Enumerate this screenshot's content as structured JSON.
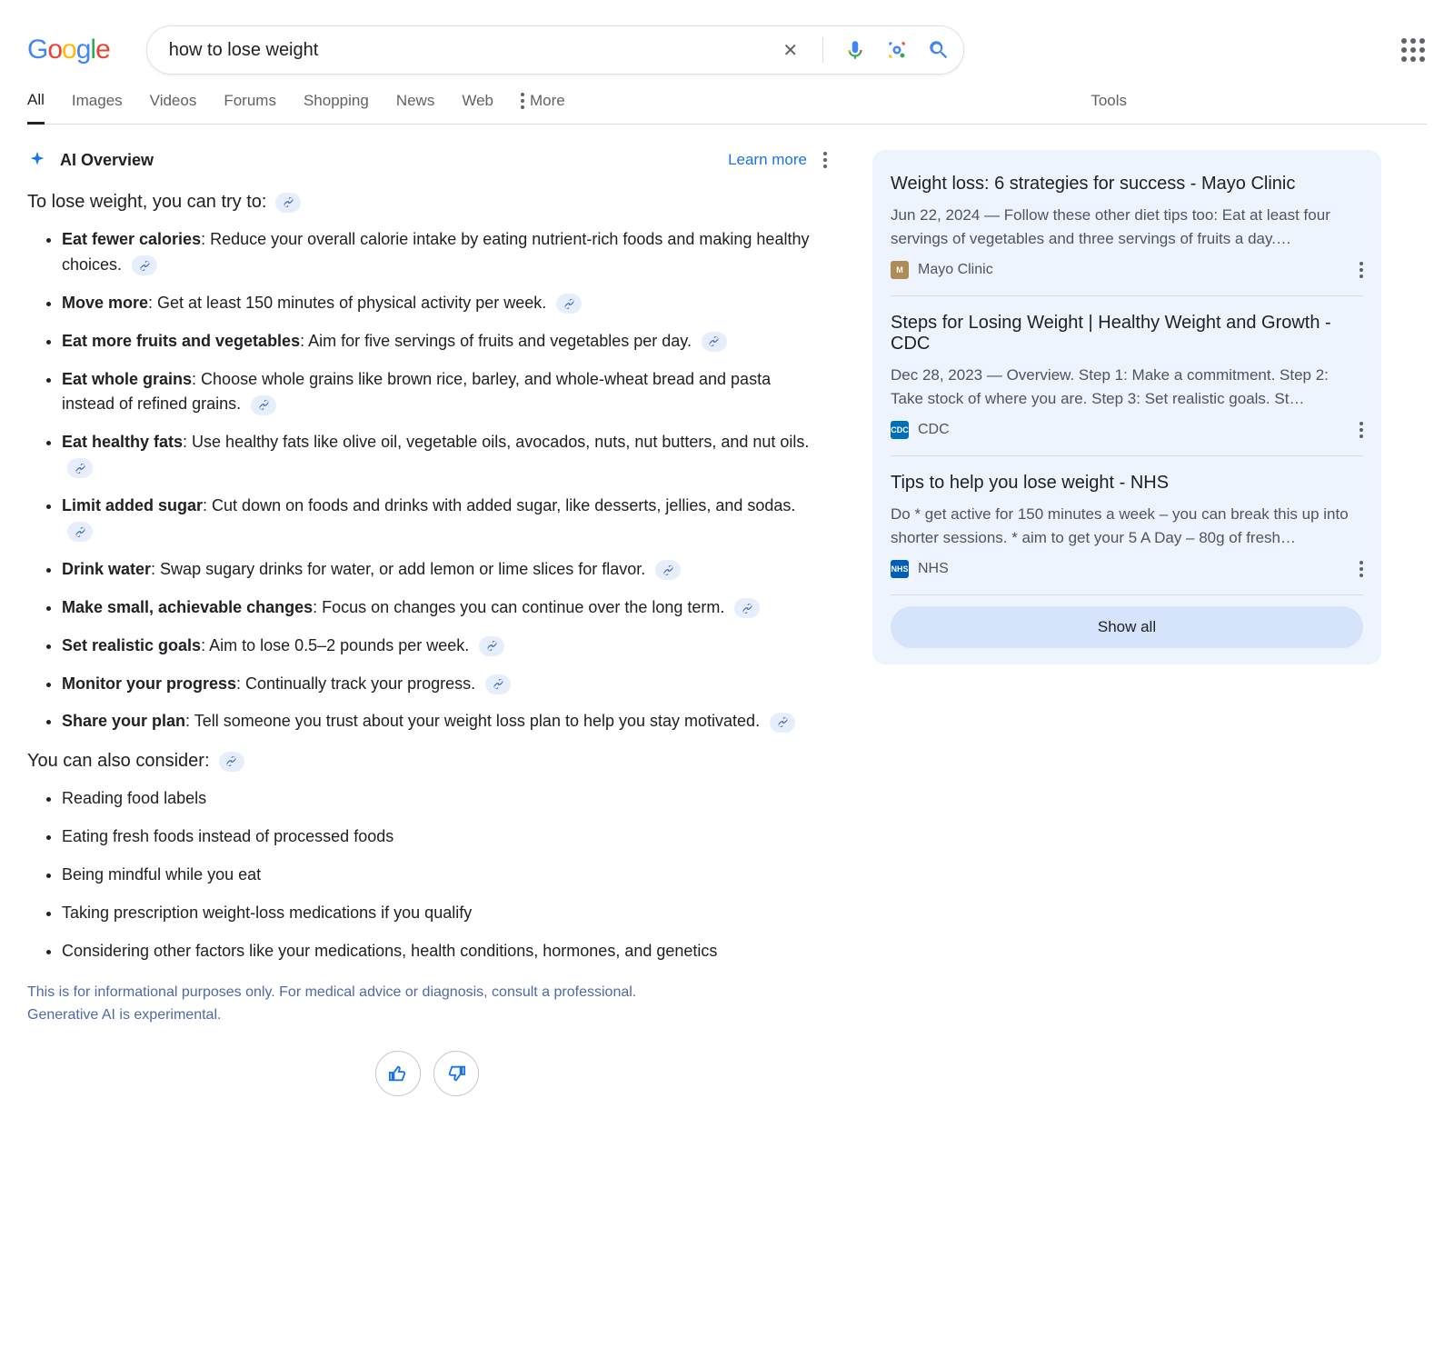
{
  "search": {
    "query": "how to lose weight"
  },
  "tabs": {
    "items": [
      "All",
      "Images",
      "Videos",
      "Forums",
      "Shopping",
      "News",
      "Web"
    ],
    "more": "More",
    "tools": "Tools"
  },
  "ai": {
    "title": "AI Overview",
    "learn_more": "Learn more",
    "lead": "To lose weight, you can try to:",
    "points": [
      {
        "b": "Eat fewer calories",
        "rest": ": Reduce your overall calorie intake by eating nutrient-rich foods and making healthy choices."
      },
      {
        "b": "Move more",
        "rest": ": Get at least 150 minutes of physical activity per week."
      },
      {
        "b": "Eat more fruits and vegetables",
        "rest": ": Aim for five servings of fruits and vegetables per day."
      },
      {
        "b": "Eat whole grains",
        "rest": ": Choose whole grains like brown rice, barley, and whole-wheat bread and pasta instead of refined grains."
      },
      {
        "b": "Eat healthy fats",
        "rest": ": Use healthy fats like olive oil, vegetable oils, avocados, nuts, nut butters, and nut oils."
      },
      {
        "b": "Limit added sugar",
        "rest": ": Cut down on foods and drinks with added sugar, like desserts, jellies, and sodas."
      },
      {
        "b": "Drink water",
        "rest": ": Swap sugary drinks for water, or add lemon or lime slices for flavor."
      },
      {
        "b": "Make small, achievable changes",
        "rest": ": Focus on changes you can continue over the long term."
      },
      {
        "b": "Set realistic goals",
        "rest": ": Aim to lose 0.5–2 pounds per week."
      },
      {
        "b": "Monitor your progress",
        "rest": ": Continually track your progress."
      },
      {
        "b": "Share your plan",
        "rest": ": Tell someone you trust about your weight loss plan to help you stay motivated."
      }
    ],
    "subhead": "You can also consider:",
    "also": [
      "Reading food labels",
      "Eating fresh foods instead of processed foods",
      "Being mindful while you eat",
      "Taking prescription weight-loss medications if you qualify",
      "Considering other factors like your medications, health conditions, hormones, and genetics"
    ],
    "disclaimer1": "This is for informational purposes only. For medical advice or diagnosis, consult a professional.",
    "disclaimer2": "Generative AI is experimental."
  },
  "sources": [
    {
      "title": "Weight loss: 6 strategies for success - Mayo Clinic",
      "date": "Jun 22, 2024",
      "snippet": "Follow these other diet tips too: Eat at least four servings of vegetables and three servings of fruits a day.…",
      "name": "Mayo Clinic",
      "fav_bg": "#b08b57",
      "fav_txt": "M"
    },
    {
      "title": "Steps for Losing Weight | Healthy Weight and Growth - CDC",
      "date": "Dec 28, 2023",
      "snippet": "Overview. Step 1: Make a commitment. Step 2: Take stock of where you are. Step 3: Set realistic goals. St…",
      "name": "CDC",
      "fav_bg": "#006fba",
      "fav_txt": "CDC"
    },
    {
      "title": "Tips to help you lose weight - NHS",
      "date": "",
      "snippet": "Do * get active for 150 minutes a week – you can break this up into shorter sessions. * aim to get your 5 A Day – 80g of fresh…",
      "name": "NHS",
      "fav_bg": "#005eb8",
      "fav_txt": "NHS"
    }
  ],
  "show_all": "Show all"
}
